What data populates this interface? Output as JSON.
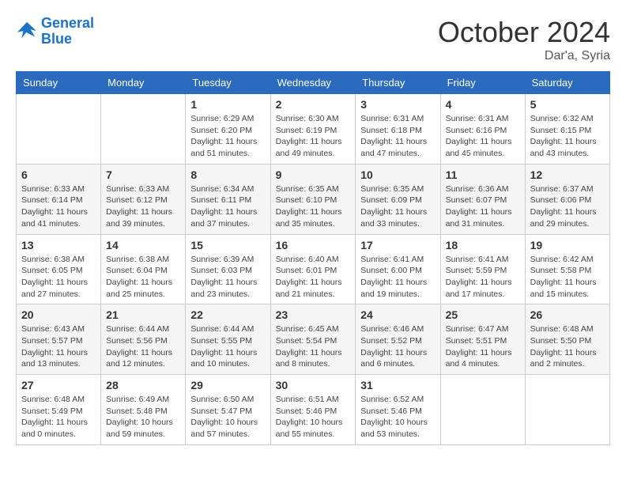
{
  "logo": {
    "line1": "General",
    "line2": "Blue"
  },
  "title": "October 2024",
  "subtitle": "Dar'a, Syria",
  "days_header": [
    "Sunday",
    "Monday",
    "Tuesday",
    "Wednesday",
    "Thursday",
    "Friday",
    "Saturday"
  ],
  "weeks": [
    [
      {
        "day": "",
        "info": ""
      },
      {
        "day": "",
        "info": ""
      },
      {
        "day": "1",
        "info": "Sunrise: 6:29 AM\nSunset: 6:20 PM\nDaylight: 11 hours and 51 minutes."
      },
      {
        "day": "2",
        "info": "Sunrise: 6:30 AM\nSunset: 6:19 PM\nDaylight: 11 hours and 49 minutes."
      },
      {
        "day": "3",
        "info": "Sunrise: 6:31 AM\nSunset: 6:18 PM\nDaylight: 11 hours and 47 minutes."
      },
      {
        "day": "4",
        "info": "Sunrise: 6:31 AM\nSunset: 6:16 PM\nDaylight: 11 hours and 45 minutes."
      },
      {
        "day": "5",
        "info": "Sunrise: 6:32 AM\nSunset: 6:15 PM\nDaylight: 11 hours and 43 minutes."
      }
    ],
    [
      {
        "day": "6",
        "info": "Sunrise: 6:33 AM\nSunset: 6:14 PM\nDaylight: 11 hours and 41 minutes."
      },
      {
        "day": "7",
        "info": "Sunrise: 6:33 AM\nSunset: 6:12 PM\nDaylight: 11 hours and 39 minutes."
      },
      {
        "day": "8",
        "info": "Sunrise: 6:34 AM\nSunset: 6:11 PM\nDaylight: 11 hours and 37 minutes."
      },
      {
        "day": "9",
        "info": "Sunrise: 6:35 AM\nSunset: 6:10 PM\nDaylight: 11 hours and 35 minutes."
      },
      {
        "day": "10",
        "info": "Sunrise: 6:35 AM\nSunset: 6:09 PM\nDaylight: 11 hours and 33 minutes."
      },
      {
        "day": "11",
        "info": "Sunrise: 6:36 AM\nSunset: 6:07 PM\nDaylight: 11 hours and 31 minutes."
      },
      {
        "day": "12",
        "info": "Sunrise: 6:37 AM\nSunset: 6:06 PM\nDaylight: 11 hours and 29 minutes."
      }
    ],
    [
      {
        "day": "13",
        "info": "Sunrise: 6:38 AM\nSunset: 6:05 PM\nDaylight: 11 hours and 27 minutes."
      },
      {
        "day": "14",
        "info": "Sunrise: 6:38 AM\nSunset: 6:04 PM\nDaylight: 11 hours and 25 minutes."
      },
      {
        "day": "15",
        "info": "Sunrise: 6:39 AM\nSunset: 6:03 PM\nDaylight: 11 hours and 23 minutes."
      },
      {
        "day": "16",
        "info": "Sunrise: 6:40 AM\nSunset: 6:01 PM\nDaylight: 11 hours and 21 minutes."
      },
      {
        "day": "17",
        "info": "Sunrise: 6:41 AM\nSunset: 6:00 PM\nDaylight: 11 hours and 19 minutes."
      },
      {
        "day": "18",
        "info": "Sunrise: 6:41 AM\nSunset: 5:59 PM\nDaylight: 11 hours and 17 minutes."
      },
      {
        "day": "19",
        "info": "Sunrise: 6:42 AM\nSunset: 5:58 PM\nDaylight: 11 hours and 15 minutes."
      }
    ],
    [
      {
        "day": "20",
        "info": "Sunrise: 6:43 AM\nSunset: 5:57 PM\nDaylight: 11 hours and 13 minutes."
      },
      {
        "day": "21",
        "info": "Sunrise: 6:44 AM\nSunset: 5:56 PM\nDaylight: 11 hours and 12 minutes."
      },
      {
        "day": "22",
        "info": "Sunrise: 6:44 AM\nSunset: 5:55 PM\nDaylight: 11 hours and 10 minutes."
      },
      {
        "day": "23",
        "info": "Sunrise: 6:45 AM\nSunset: 5:54 PM\nDaylight: 11 hours and 8 minutes."
      },
      {
        "day": "24",
        "info": "Sunrise: 6:46 AM\nSunset: 5:52 PM\nDaylight: 11 hours and 6 minutes."
      },
      {
        "day": "25",
        "info": "Sunrise: 6:47 AM\nSunset: 5:51 PM\nDaylight: 11 hours and 4 minutes."
      },
      {
        "day": "26",
        "info": "Sunrise: 6:48 AM\nSunset: 5:50 PM\nDaylight: 11 hours and 2 minutes."
      }
    ],
    [
      {
        "day": "27",
        "info": "Sunrise: 6:48 AM\nSunset: 5:49 PM\nDaylight: 11 hours and 0 minutes."
      },
      {
        "day": "28",
        "info": "Sunrise: 6:49 AM\nSunset: 5:48 PM\nDaylight: 10 hours and 59 minutes."
      },
      {
        "day": "29",
        "info": "Sunrise: 6:50 AM\nSunset: 5:47 PM\nDaylight: 10 hours and 57 minutes."
      },
      {
        "day": "30",
        "info": "Sunrise: 6:51 AM\nSunset: 5:46 PM\nDaylight: 10 hours and 55 minutes."
      },
      {
        "day": "31",
        "info": "Sunrise: 6:52 AM\nSunset: 5:46 PM\nDaylight: 10 hours and 53 minutes."
      },
      {
        "day": "",
        "info": ""
      },
      {
        "day": "",
        "info": ""
      }
    ]
  ]
}
